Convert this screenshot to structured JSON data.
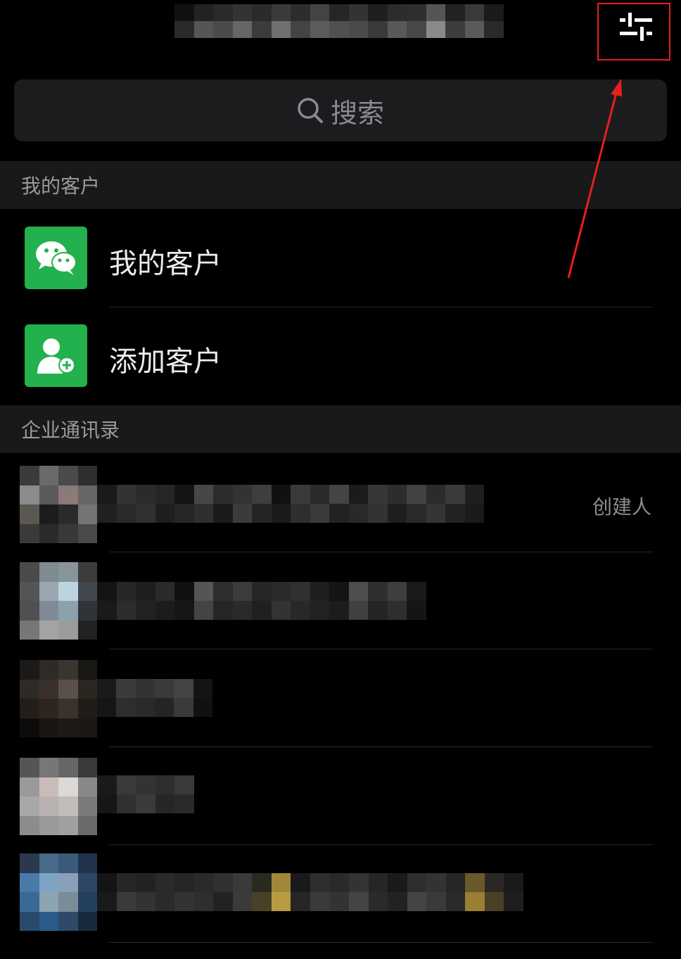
{
  "header": {
    "filter_icon": "sliders-icon",
    "highlight_color": "#e81e1e"
  },
  "search": {
    "icon": "search-icon",
    "placeholder": "搜索"
  },
  "sections": {
    "my_customers_header": "我的客户",
    "directory_header": "企业通讯录"
  },
  "menu": {
    "items": [
      {
        "label": "我的客户",
        "icon": "wechat-chat-icon",
        "color": "#22b14c"
      },
      {
        "label": "添加客户",
        "icon": "add-person-icon",
        "color": "#22b14c"
      }
    ]
  },
  "contacts": [
    {
      "name": "",
      "tag": "创建人"
    },
    {
      "name": "",
      "tag": ""
    },
    {
      "name": "",
      "tag": ""
    },
    {
      "name": "",
      "tag": ""
    },
    {
      "name": "",
      "tag": ""
    }
  ]
}
